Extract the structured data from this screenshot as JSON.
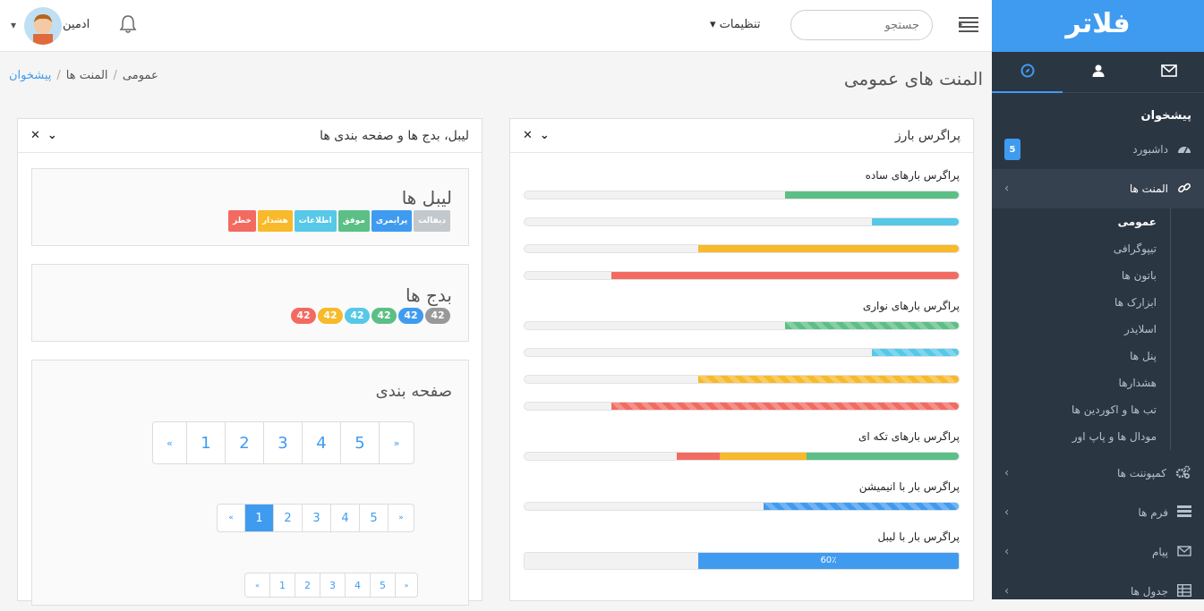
{
  "brand": "فلاتر",
  "sidebar": {
    "tabs": [
      {
        "icon": "compass-icon"
      },
      {
        "icon": "user-icon"
      },
      {
        "icon": "envelope-icon"
      }
    ],
    "section_title": "پیشخوان",
    "dashboard": {
      "label": "داشبورد",
      "badge": "5"
    },
    "elements": {
      "label": "المنت ها"
    },
    "submenu": [
      "عمومی",
      "تیپوگرافی",
      "باتون ها",
      "ابزارک ها",
      "اسلایدر",
      "پنل ها",
      "هشدارها",
      "تب ها و اکوردین ها",
      "مودال ها و پاپ اور"
    ],
    "components": {
      "label": "کمپوننت ها"
    },
    "forms": {
      "label": "فرم ها"
    },
    "messages": {
      "label": "پیام"
    },
    "tables": {
      "label": "جدول ها"
    }
  },
  "topbar": {
    "search_placeholder": "جستجو",
    "settings_label": "تنظیمات",
    "user_name": "ادمین"
  },
  "header": {
    "title": "المنت های عمومی",
    "breadcrumb": [
      "پیشخوان",
      "المنت ها",
      "عمومی"
    ]
  },
  "progress_panel": {
    "title": "پراگرس بارز",
    "simple_title": "پراگرس بارهای ساده",
    "striped_title": "پراگرس بارهای نواری",
    "stacked_title": "پراگرس بارهای تکه ای",
    "animated_title": "پراگرس بار با انیمیشن",
    "labeled_title": "پراگرس بار با لیبل",
    "simple_values": [
      40,
      20,
      60,
      80
    ],
    "striped_values": [
      40,
      20,
      60,
      80
    ],
    "stacked_values": [
      35,
      20,
      10
    ],
    "animated_value": 45,
    "labeled_value": 60,
    "labeled_text": "60٪",
    "colors": {
      "green": "#5cbf85",
      "cyan": "#56c8e8",
      "orange": "#f8b92a",
      "red": "#f36a61",
      "blue": "#3f9bf0"
    }
  },
  "labels_panel": {
    "title": "لیبل، بدج ها و صفحه بندی ها",
    "labels_title": "لیبل ها",
    "labels": [
      "دیفالت",
      "پرایمری",
      "موفق",
      "اطلاعات",
      "هشدار",
      "خطر"
    ],
    "badges_title": "بدج ها",
    "badges": [
      "42",
      "42",
      "42",
      "42",
      "42",
      "42"
    ],
    "pagination_title": "صفحه بندی",
    "pages": [
      "«",
      "1",
      "2",
      "3",
      "4",
      "5",
      "»"
    ]
  }
}
